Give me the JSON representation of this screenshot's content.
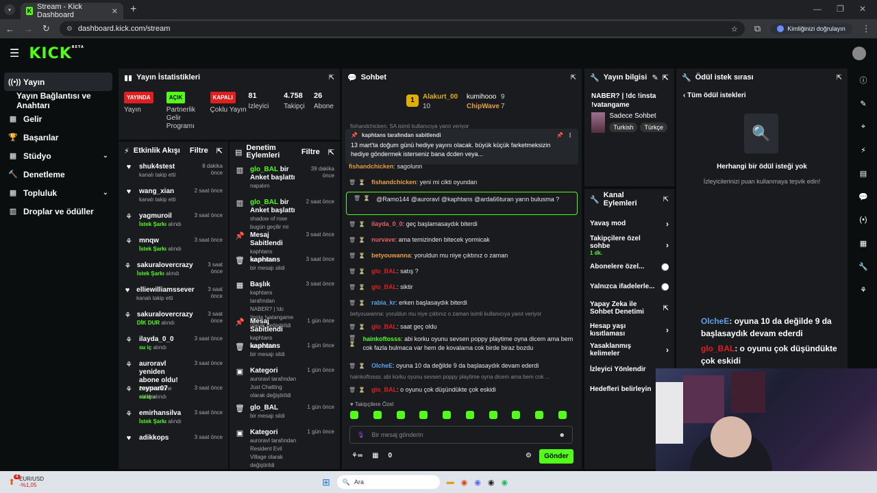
{
  "browser": {
    "tab_title": "Stream - Kick Dashboard",
    "tab_fav": "K",
    "url": "dashboard.kick.com/stream",
    "verify_label": "Kimliğinizi doğrulayın"
  },
  "brand": {
    "logo": "KICK",
    "beta": "BETA"
  },
  "sidebar": {
    "items": [
      {
        "icon": "broadcast-icon",
        "glyph": "((•))",
        "label": "Yayın"
      },
      {
        "icon": "",
        "glyph": "",
        "label": "Yayın Bağlantısı ve Anahtarı"
      },
      {
        "icon": "income-icon",
        "glyph": "▦",
        "label": "Gelir"
      },
      {
        "icon": "trophy-icon",
        "glyph": "🏆",
        "label": "Başarılar"
      },
      {
        "icon": "studio-icon",
        "glyph": "▦",
        "label": "Stüdyo"
      },
      {
        "icon": "moderation-icon",
        "glyph": "🔨",
        "label": "Denetleme"
      },
      {
        "icon": "community-icon",
        "glyph": "▦",
        "label": "Topluluk"
      },
      {
        "icon": "drops-icon",
        "glyph": "▥",
        "label": "Droplar ve ödüller"
      }
    ]
  },
  "stats_panel": {
    "title": "Yayın İstatistikleri",
    "stats": [
      {
        "badge": "YAYINDA",
        "badge_color": "#e0201e",
        "label": "Yayın"
      },
      {
        "badge": "AÇIK",
        "badge_color": "#53fc18",
        "label": "Partnerlik Gelir Programı"
      },
      {
        "badge": "KAPALI",
        "badge_color": "#e0201e",
        "label": "Çoklu Yayın"
      },
      {
        "value": "81",
        "label": "İzleyici"
      },
      {
        "value": "4.758",
        "label": "Takipçi"
      },
      {
        "value": "26",
        "label": "Abone Sayısı"
      }
    ]
  },
  "activity": {
    "title": "Etkinlik Akışı",
    "filter": "Filtre",
    "rows": [
      {
        "user": "shuk4stest",
        "sub": "kanalı takip etti",
        "time": "8 dakika önce",
        "hl": false
      },
      {
        "user": "wang_xian",
        "sub": "kanalı takip etti",
        "time": "2 saat önce",
        "hl": false
      },
      {
        "user": "yagmuroil",
        "sub": "İstek Şarkı",
        "sub2": "alındı",
        "time": "3 saat önce",
        "hl": true
      },
      {
        "user": "mnqw",
        "sub": "İstek Şarkı",
        "sub2": "alındı",
        "time": "3 saat önce",
        "hl": true
      },
      {
        "user": "sakuralovercrazy",
        "sub": "İstek Şarkı",
        "sub2": "alındı",
        "time": "3 saat önce",
        "hl": true
      },
      {
        "user": "elliewilliamssever",
        "sub": "kanalı takip etti",
        "time": "3 saat önce",
        "hl": false
      },
      {
        "user": "sakuralovercrazy",
        "sub": "DİK DUR",
        "sub2": "alındı",
        "time": "3 saat önce",
        "hl": true
      },
      {
        "user": "ilayda_0_0",
        "sub": "su iç",
        "sub2": "alındı",
        "time": "3 saat önce",
        "hl": true
      },
      {
        "user": "auroravl yeniden abone oldu!",
        "sub": "2",
        "sub2": "aylık abone oldular",
        "time": "3 saat önce",
        "hl": true
      },
      {
        "user": "reypar07",
        "sub": "su iç",
        "sub2": "alındı",
        "time": "3 saat önce",
        "hl": true
      },
      {
        "user": "emirhansilva",
        "sub": "İstek Şarkı",
        "sub2": "alındı",
        "time": "3 saat önce",
        "hl": true
      },
      {
        "user": "adikkops",
        "sub": "",
        "time": "3 saat önce",
        "hl": false
      }
    ]
  },
  "moderation": {
    "title": "Denetim Eylemleri",
    "filter": "Filtre",
    "rows": [
      {
        "who": "glo_BAL",
        "what": "bir Anket başlattı",
        "sub": "napalım",
        "time": "39 dakika önce"
      },
      {
        "who": "glo_BAL",
        "what": "bir Anket başlattı",
        "sub": "shadow of rose bugün geçilir mi",
        "time": "2 saat önce"
      },
      {
        "who": "",
        "what": "Mesaj Sabitlendi",
        "sub": "kaphtans tarafından",
        "time": "3 saat önce"
      },
      {
        "who": "",
        "what": "kaphtans",
        "sub": "bir mesajı sildi",
        "time": "3 saat önce"
      },
      {
        "who": "",
        "what": "Başlık",
        "sub": "kaphtans tarafından NABER? | !dc !insta !vatangame olarak değiştirildi",
        "time": "3 saat önce"
      },
      {
        "who": "",
        "what": "Mesaj Sabitlendi",
        "sub": "kaphtans tarafından",
        "time": "1 gün önce"
      },
      {
        "who": "",
        "what": "kaphtans",
        "sub": "bir mesajı sildi",
        "time": "1 gün önce"
      },
      {
        "who": "",
        "what": "Kategori",
        "sub": "auroravl tarafından Just Chatting olarak değiştirildi",
        "time": "1 gün önce"
      },
      {
        "who": "",
        "what": "glo_BAL",
        "sub": "bir mesajı sildi",
        "time": "1 gün önce"
      },
      {
        "who": "",
        "what": "Kategori",
        "sub": "auroravl tarafından Resident Evil Village olarak değiştirildi",
        "time": "1 gün önce"
      }
    ]
  },
  "chat": {
    "title": "Sohbet",
    "leaders": [
      {
        "name": "Alakurt_00",
        "val": "10",
        "color": "#e0b000"
      },
      {
        "name": "kumihooo",
        "val": "9",
        "color": "#fff"
      },
      {
        "name": "ChipWave",
        "val": "7",
        "color": "#e8a040"
      }
    ],
    "pinned_by": "kaphtans tarafından sabitlendi",
    "pinned_text": "13 mart'ta doğum günü hediye yayını olacak. büyük küçük farketmeksizin hediye göndermek isterseniz bana dcden veya...",
    "reply_note_top": "fishandchicken: SA isimli kullanıcıya yanıt veriyor",
    "messages": [
      {
        "user": "fishandchicken",
        "color": "#e8a040",
        "text": "sagolunn"
      },
      {
        "user": "fishandchicken",
        "color": "#e8a040",
        "text": "yeni mi cikti oyundan"
      },
      {
        "user": "",
        "color": "#fff",
        "text": "@Ramo144 @auroravl @kaphtans @arda66turan yarın bulusma ?"
      },
      {
        "user": "ilayda_0_0",
        "color": "#e86060",
        "text": "geç başlamasaydık biterdi"
      },
      {
        "user": "nurvave",
        "color": "#e86060",
        "text": "ama temizinden bitecek yormicak"
      },
      {
        "user": "betyouwanna",
        "color": "#e8a040",
        "text": "yoruldun mu niye çıktınız o zaman"
      },
      {
        "user": "glo_BAL",
        "color": "#e02020",
        "text": "satış ?"
      },
      {
        "user": "glo_BAL",
        "color": "#e02020",
        "text": "siktir"
      },
      {
        "user": "rabia_kr",
        "color": "#60a0e8",
        "text": "erken başlasaydık biterdi"
      },
      {
        "user": "glo_BAL",
        "color": "#e02020",
        "text": "saat geç oldu",
        "reply": "betyouwanna: yoruldun mu niye çıktınız o zaman isimli kullanıcıya yanıt veriyor"
      },
      {
        "user": "hainkoftosss",
        "color": "#53fc18",
        "text": "abi korku oyunu sevsen poppy playtime oyna dicem ama bem cok fazla bulmaca var hem de kovalama cok birde biraz bozdu"
      },
      {
        "user": "OlcheE",
        "color": "#60a0e8",
        "text": "oyuna 10 da değilde 9 da başlasaydık devam ederdi"
      },
      {
        "user": "glo_BAL",
        "color": "#e02020",
        "text": "o oyunu çok düşündükte çok eskidi",
        "reply": "hainkoftosss: abi korku oyunu sevsen poppy playtime oyna dicem ama bem cok ..."
      }
    ],
    "follower_only": "Takipçilere Özel",
    "input_placeholder": "Bir mesaj gönderin",
    "points": "0",
    "send": "Gönder"
  },
  "stream_info": {
    "title": "Yayın bilgisi",
    "stream_title": "NABER? | !dc !insta !vatangame",
    "category": "Sadece Sohbet",
    "tags": [
      "Turkish",
      "Türkçe"
    ]
  },
  "channel_actions": {
    "title": "Kanal Eylemleri",
    "items": [
      {
        "label": "Yavaş mod",
        "type": "chev"
      },
      {
        "label": "Takipçilere özel sohbe",
        "sub": "1 dk.",
        "type": "chev"
      },
      {
        "label": "Abonelere özel...",
        "type": "toggle"
      },
      {
        "label": "Yalnızca ifadelerle...",
        "type": "toggle"
      },
      {
        "label": "Yapay Zeka ile Sohbet Denetimi",
        "type": "pop"
      },
      {
        "label": "Hesap yaşı kısıtlaması",
        "type": "chev"
      },
      {
        "label": "Yasaklanmış kelimeler",
        "type": "chev"
      },
      {
        "label": "İzleyici Yönlendir",
        "type": "none"
      },
      {
        "label": "Hedefleri belirleyin",
        "type": "none"
      }
    ]
  },
  "rewards": {
    "title": "Ödül istek sırası",
    "back": "Tüm ödül istekleri",
    "empty_title": "Herhangi bir ödül isteği yok",
    "empty_sub": "İzleyicilerinizi puan kullanmaya teşvik edin!"
  },
  "overlay_chat": [
    {
      "user": "OlcheE",
      "text": ": oyuna 10 da değilde 9 da başlasaydık devam ederdi"
    },
    {
      "user": "glo_BAL",
      "text": ": o oyunu çok düşündükte çok eskidi"
    }
  ],
  "taskbar": {
    "ticker_name": "EUR/USD",
    "ticker_change": "-%1,05",
    "badge": "4",
    "search": "Ara"
  },
  "colors": {
    "accent": "#53fc18",
    "panel": "#191b1f",
    "bg": "#0b0e0f",
    "live": "#e0201e"
  }
}
